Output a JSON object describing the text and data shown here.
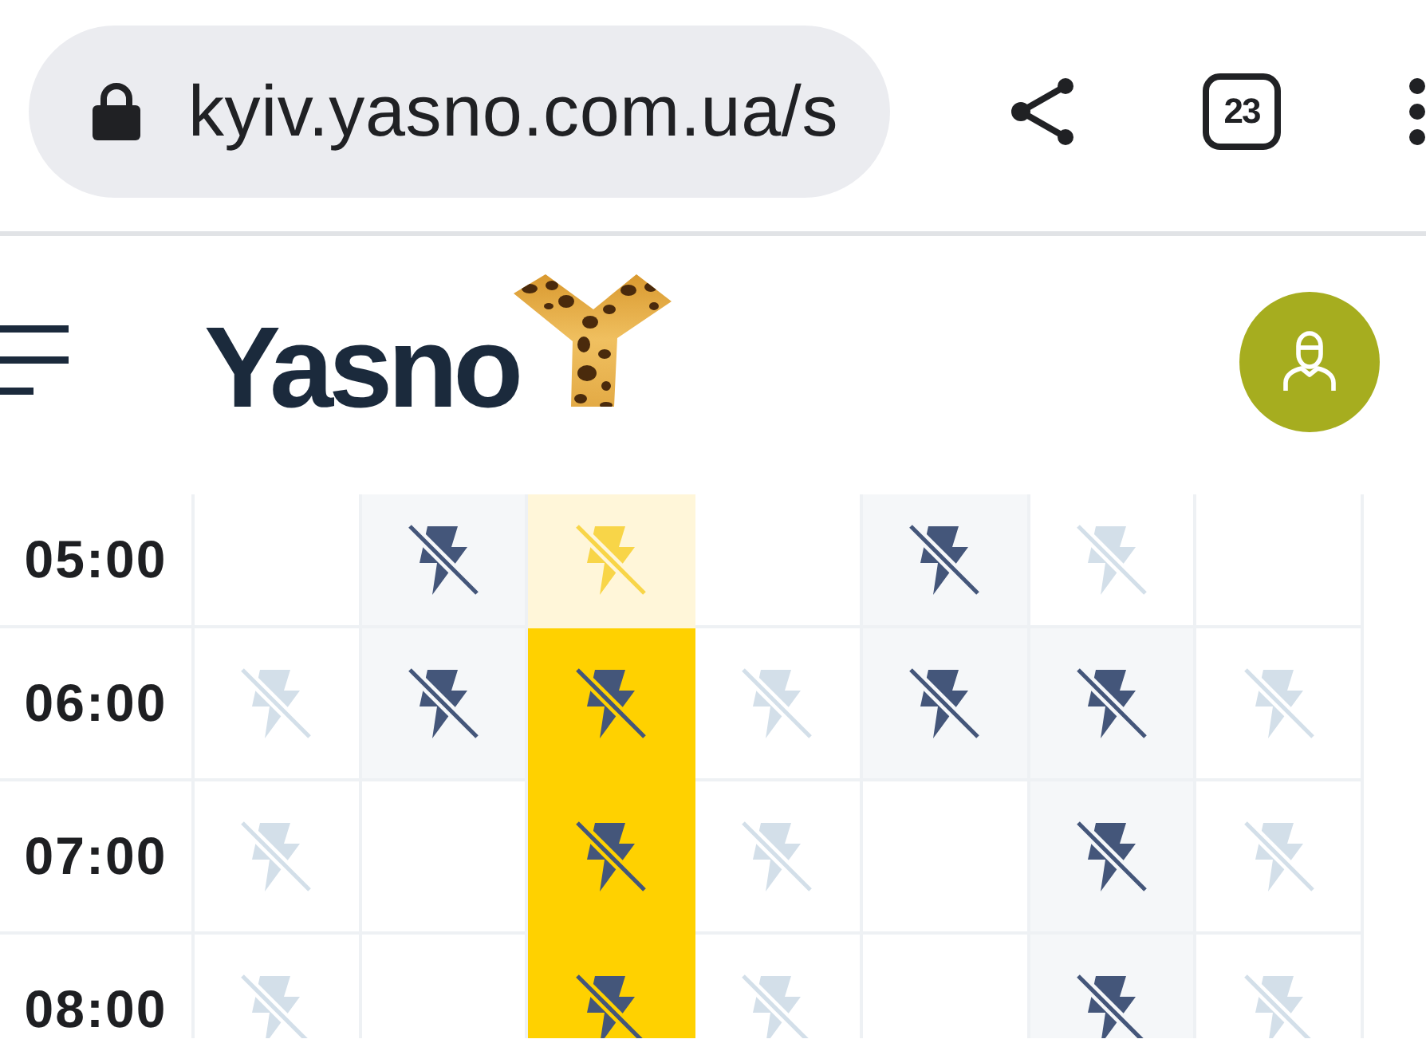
{
  "browser": {
    "url": "kyiv.yasno.com.ua/s",
    "tab_count": "23"
  },
  "header": {
    "logo_text": "Yasno"
  },
  "schedule": {
    "columns": [
      {
        "selected": false
      },
      {
        "selected": false
      },
      {
        "selected": true
      },
      {
        "selected": false
      },
      {
        "selected": false
      },
      {
        "selected": false
      },
      {
        "selected": false
      }
    ],
    "rows": [
      {
        "time": "05:00",
        "past": true,
        "cells": [
          {
            "kind": "none"
          },
          {
            "kind": "definite"
          },
          {
            "kind": "definite"
          },
          {
            "kind": "none"
          },
          {
            "kind": "definite"
          },
          {
            "kind": "possible"
          },
          {
            "kind": "none"
          }
        ]
      },
      {
        "time": "06:00",
        "past": false,
        "cells": [
          {
            "kind": "possible"
          },
          {
            "kind": "definite"
          },
          {
            "kind": "definite"
          },
          {
            "kind": "possible"
          },
          {
            "kind": "definite"
          },
          {
            "kind": "definite"
          },
          {
            "kind": "possible"
          }
        ]
      },
      {
        "time": "07:00",
        "past": false,
        "cells": [
          {
            "kind": "possible"
          },
          {
            "kind": "none"
          },
          {
            "kind": "definite"
          },
          {
            "kind": "possible"
          },
          {
            "kind": "none"
          },
          {
            "kind": "definite"
          },
          {
            "kind": "possible"
          }
        ]
      },
      {
        "time": "08:00",
        "past": false,
        "cells": [
          {
            "kind": "possible"
          },
          {
            "kind": "none"
          },
          {
            "kind": "definite"
          },
          {
            "kind": "possible"
          },
          {
            "kind": "none"
          },
          {
            "kind": "definite"
          },
          {
            "kind": "possible"
          }
        ]
      }
    ]
  }
}
